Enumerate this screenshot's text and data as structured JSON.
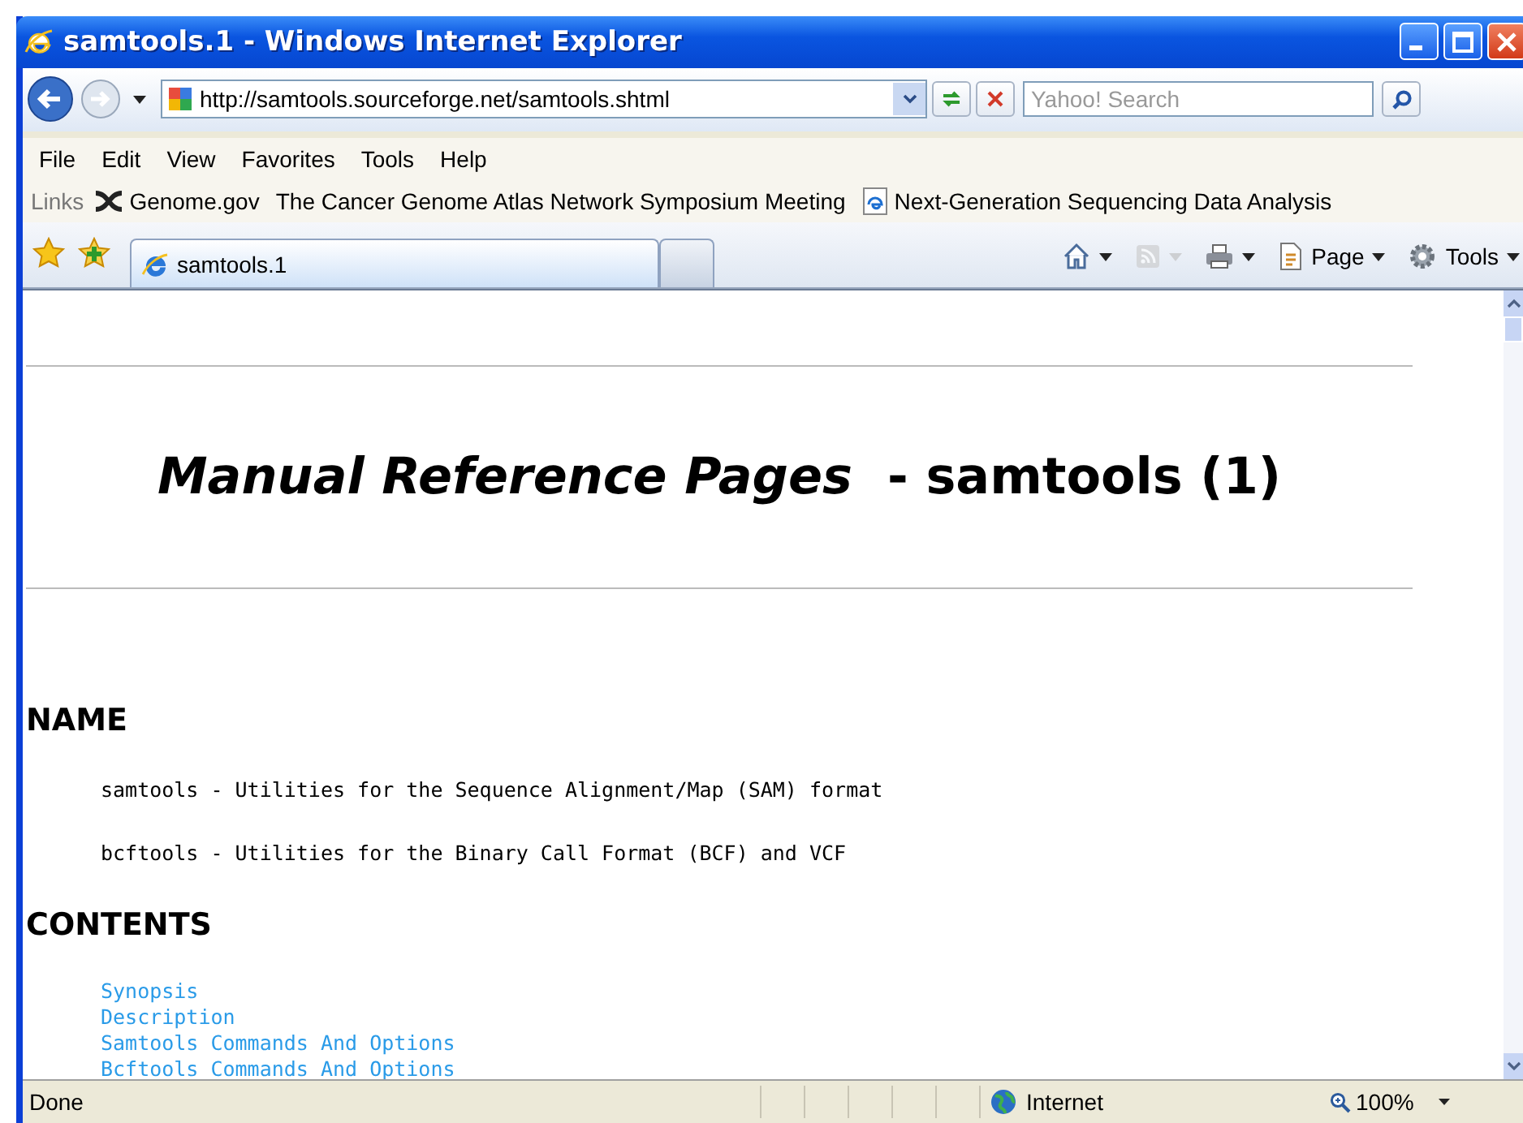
{
  "window": {
    "title": "samtools.1 - Windows Internet Explorer"
  },
  "address_bar": {
    "url": "http://samtools.sourceforge.net/samtools.shtml"
  },
  "search": {
    "placeholder": "Yahoo! Search"
  },
  "menu": [
    "File",
    "Edit",
    "View",
    "Favorites",
    "Tools",
    "Help"
  ],
  "links_bar": {
    "label": "Links",
    "items": [
      {
        "label": "Genome.gov",
        "kind": "helix"
      },
      {
        "label": "The Cancer Genome Atlas Network Symposium Meeting",
        "kind": "plain"
      },
      {
        "label": "Next-Generation Sequencing Data Analysis",
        "kind": "page"
      }
    ]
  },
  "tabs": [
    {
      "label": "samtools.1",
      "selected": true
    }
  ],
  "command_bar": [
    {
      "kind": "home",
      "disabled": false
    },
    {
      "kind": "feeds",
      "disabled": true
    },
    {
      "kind": "print",
      "disabled": false
    },
    {
      "kind": "page",
      "label": "Page",
      "disabled": false
    },
    {
      "kind": "tools",
      "label": "Tools",
      "disabled": false
    }
  ],
  "page": {
    "title": "*Manual Reference Pages*  - samtools (1)",
    "sections": [
      {
        "heading": "NAME",
        "lines": [
          "samtools - Utilities for the Sequence Alignment/Map (SAM) format",
          "bcftools - Utilities for the Binary Call Format (BCF) and VCF"
        ]
      },
      {
        "heading": "CONTENTS",
        "links": [
          "Synopsis",
          "Description",
          "Samtools Commands And Options",
          "Bcftools Commands And Options"
        ]
      }
    ]
  },
  "status_bar": {
    "text": "Done",
    "zone": "Internet",
    "zoom": "100%"
  }
}
